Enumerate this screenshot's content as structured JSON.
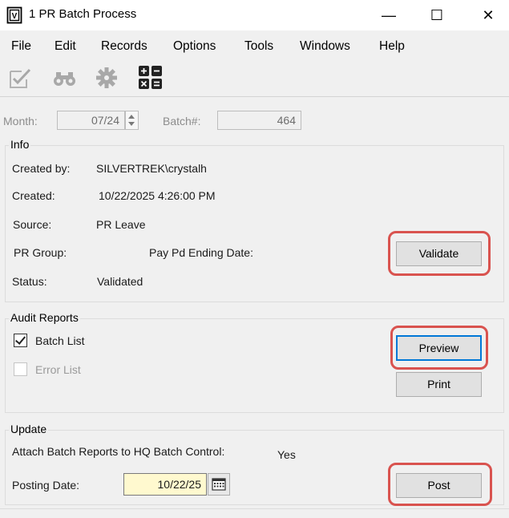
{
  "window": {
    "title": "1 PR Batch Process",
    "minimize_glyph": "—",
    "maximize_glyph": "☐",
    "close_glyph": "✕"
  },
  "menu": [
    "File",
    "Edit",
    "Records",
    "Options",
    "Tools",
    "Windows",
    "Help"
  ],
  "toolbar": {
    "icons": [
      "validate-check-icon",
      "binoculars-find-icon",
      "gear-settings-icon",
      "calculator-icon"
    ]
  },
  "header": {
    "month_label": "Month:",
    "month_value": "07/24",
    "batch_label": "Batch#:",
    "batch_value": "464"
  },
  "info": {
    "title": "Info",
    "created_by_label": "Created by:",
    "created_by_value": "SILVERTREK\\crystalh",
    "created_label": "Created:",
    "created_value": "10/22/2025 4:26:00 PM",
    "source_label": "Source:",
    "source_value": "PR Leave",
    "pr_group_label": "PR Group:",
    "pay_pd_label": "Pay Pd Ending Date:",
    "status_label": "Status:",
    "status_value": "Validated",
    "validate_button": "Validate"
  },
  "audit": {
    "title": "Audit Reports",
    "batch_list_label": "Batch List",
    "batch_list_checked": true,
    "error_list_label": "Error List",
    "error_list_checked": false,
    "preview_button": "Preview",
    "print_button": "Print"
  },
  "update": {
    "title": "Update",
    "attach_label": "Attach Batch Reports to HQ Batch Control:",
    "attach_value": "Yes",
    "posting_date_label": "Posting Date:",
    "posting_date_value": "10/22/25",
    "post_button": "Post"
  },
  "colors": {
    "highlight": "#d9534f",
    "focus": "#0078d7",
    "date_field_bg": "#fff9cf"
  }
}
